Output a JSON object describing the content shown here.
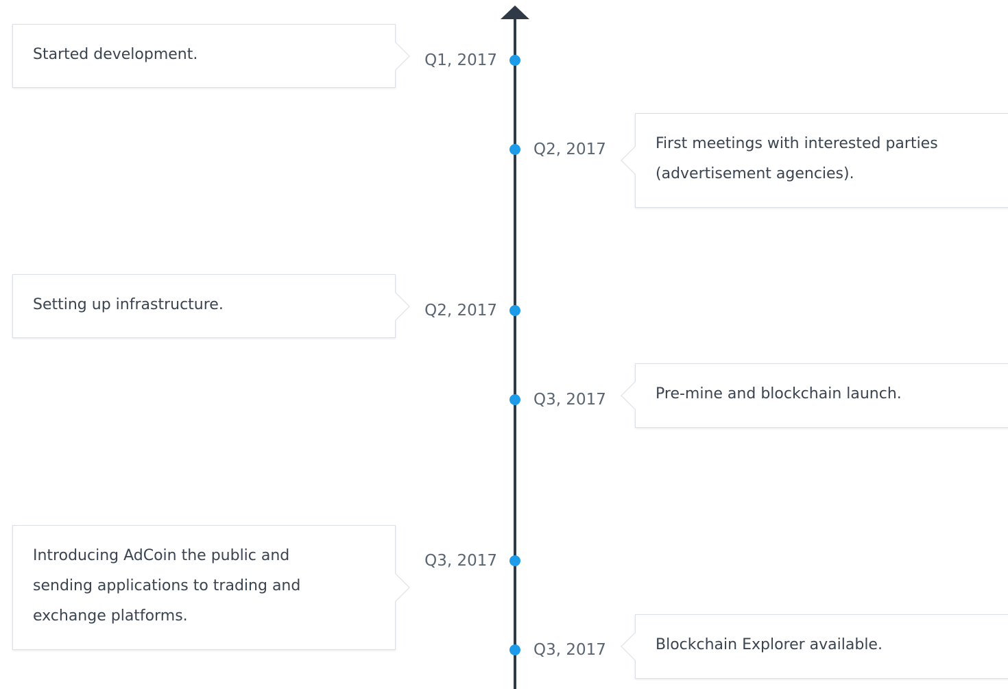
{
  "timeline": {
    "accent_color": "#1e9be9",
    "axis_color": "#2f3a46",
    "events": [
      {
        "date": "Q1, 2017",
        "side": "left",
        "text": "Started development."
      },
      {
        "date": "Q2, 2017",
        "side": "right",
        "text": "First meetings with interested parties (advertisement agencies)."
      },
      {
        "date": "Q2, 2017",
        "side": "left",
        "text": "Setting up infrastructure."
      },
      {
        "date": "Q3, 2017",
        "side": "right",
        "text": "Pre-mine and blockchain launch."
      },
      {
        "date": "Q3, 2017",
        "side": "left",
        "text": "Introducing AdCoin the public and sending applications to trading and exchange platforms."
      },
      {
        "date": "Q3, 2017",
        "side": "right",
        "text": "Blockchain Explorer available."
      }
    ]
  }
}
